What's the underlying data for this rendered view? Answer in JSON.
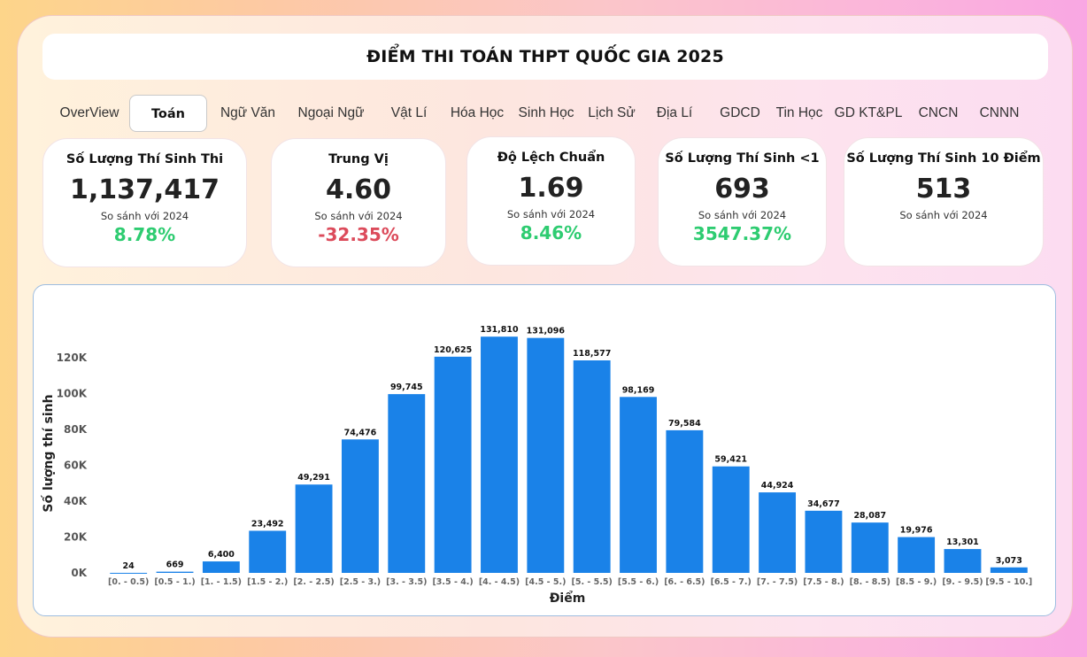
{
  "header": {
    "title": "ĐIỂM THI TOÁN THPT QUỐC GIA 2025"
  },
  "tabs": [
    {
      "label": "OverView"
    },
    {
      "label": "Toán",
      "active": true
    },
    {
      "label": "Ngữ Văn"
    },
    {
      "label": "Ngoại Ngữ"
    },
    {
      "label": "Vật Lí"
    },
    {
      "label": "Hóa Học"
    },
    {
      "label": "Sinh Học"
    },
    {
      "label": "Lịch Sử"
    },
    {
      "label": "Địa Lí"
    },
    {
      "label": "GDCD"
    },
    {
      "label": "Tin Học"
    },
    {
      "label": "GD KT&PL"
    },
    {
      "label": "CNCN"
    },
    {
      "label": "CNNN"
    }
  ],
  "kpis": [
    {
      "title": "Số Lượng Thí Sinh Thi",
      "value": "1,137,417",
      "compare": "So sánh với 2024",
      "delta": "8.78%",
      "delta_color": "#2ecc71"
    },
    {
      "title": "Trung Vị",
      "value": "4.60",
      "compare": "So sánh với 2024",
      "delta": "-32.35%",
      "delta_color": "#dc4b5b"
    },
    {
      "title": "Độ Lệch Chuẩn",
      "value": "1.69",
      "compare": "So sánh với 2024",
      "delta": "8.46%",
      "delta_color": "#2ecc71"
    },
    {
      "title": "Số Lượng Thí Sinh <1",
      "value": "693",
      "compare": "So sánh với 2024",
      "delta": "3547.37%",
      "delta_color": "#2ecc71"
    },
    {
      "title": "Số Lượng Thí Sinh 10 Điểm",
      "value": "513",
      "compare": "So sánh với 2024",
      "delta": ""
    }
  ],
  "chart_data": {
    "type": "bar",
    "title": "",
    "xlabel": "Điểm",
    "ylabel": "Số lượng thí sinh",
    "ylim": [
      0,
      140000
    ],
    "yticks": [
      0,
      20000,
      40000,
      60000,
      80000,
      100000,
      120000
    ],
    "ytick_labels": [
      "0K",
      "20K",
      "40K",
      "60K",
      "80K",
      "100K",
      "120K"
    ],
    "bar_color": "#1a82e8",
    "grid": false,
    "categories": [
      "[0. - 0.5)",
      "[0.5 - 1.)",
      "[1. - 1.5)",
      "[1.5 - 2.)",
      "[2. - 2.5)",
      "[2.5 - 3.)",
      "[3. - 3.5)",
      "[3.5 - 4.)",
      "[4. - 4.5)",
      "[4.5 - 5.)",
      "[5. - 5.5)",
      "[5.5 - 6.)",
      "[6. - 6.5)",
      "[6.5 - 7.)",
      "[7. - 7.5)",
      "[7.5 - 8.)",
      "[8. - 8.5)",
      "[8.5 - 9.)",
      "[9. - 9.5)",
      "[9.5 - 10.]"
    ],
    "values": [
      24,
      669,
      6400,
      23492,
      49291,
      74476,
      99745,
      120625,
      131810,
      131096,
      118577,
      98169,
      79584,
      59421,
      44924,
      34677,
      28087,
      19976,
      13301,
      3073
    ],
    "value_labels": [
      "24",
      "669",
      "6,400",
      "23,492",
      "49,291",
      "74,476",
      "99,745",
      "120,625",
      "131,810",
      "131,096",
      "118,577",
      "98,169",
      "79,584",
      "59,421",
      "44,924",
      "34,677",
      "28,087",
      "19,976",
      "13,301",
      "3,073"
    ]
  }
}
